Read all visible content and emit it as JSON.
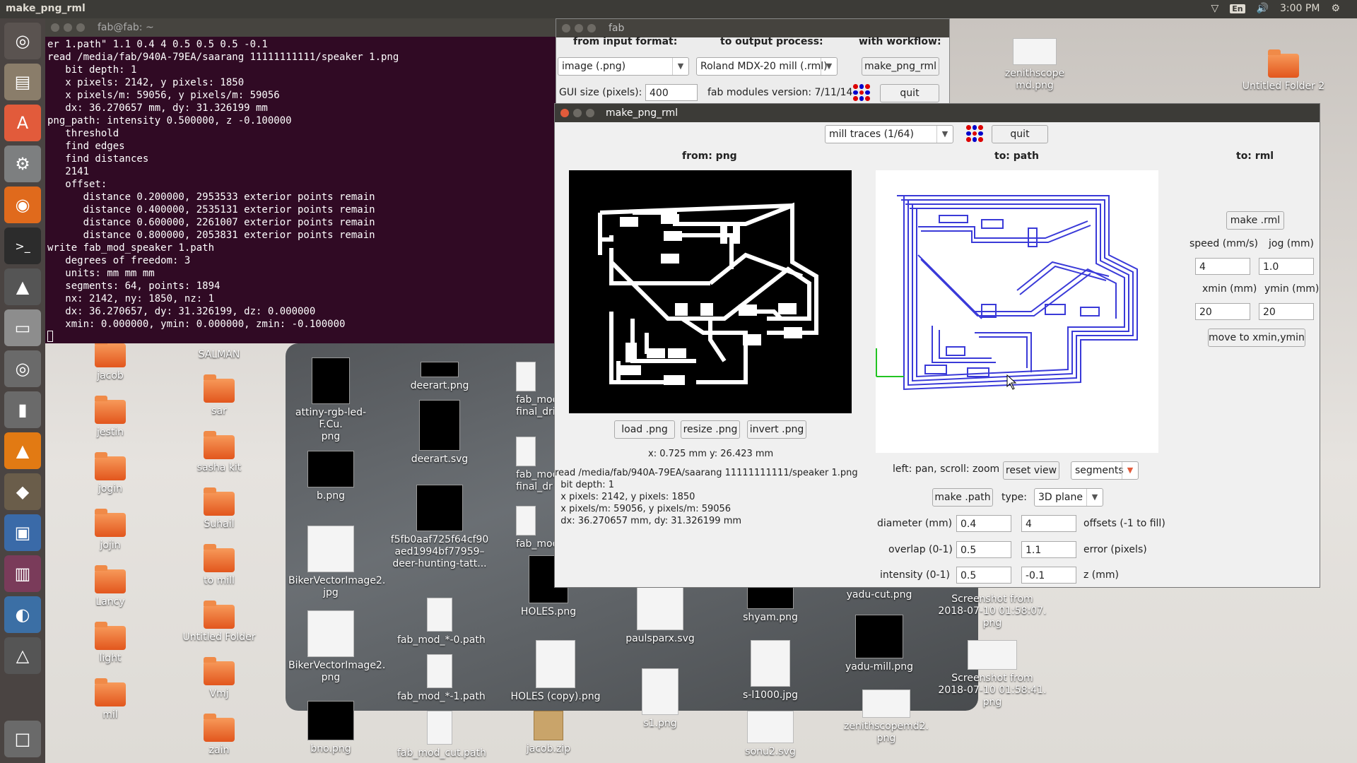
{
  "topbar": {
    "app_title": "make_png_rml",
    "lang": "En",
    "time": "3:00 PM"
  },
  "launcher": {
    "items": [
      "ubuntu-dash-icon",
      "files-icon",
      "software-center-icon",
      "settings-icon",
      "firefox-icon",
      "terminal-icon",
      "inkscape-icon",
      "disk-icon",
      "dvd-icon",
      "usb-icon",
      "vlc-icon",
      "gimp-icon",
      "video-editor-icon",
      "film-icon",
      "python-icon",
      "updater-icon",
      "trash-icon"
    ]
  },
  "terminal": {
    "title": "fab@fab: ~",
    "lines": [
      "er 1.path\" 1.1 0.4 4 0.5 0.5 0.5 -0.1",
      "read /media/fab/940A-79EA/saarang 11111111111/speaker 1.png",
      "   bit depth: 1",
      "   x pixels: 2142, y pixels: 1850",
      "   x pixels/m: 59056, y pixels/m: 59056",
      "   dx: 36.270657 mm, dy: 31.326199 mm",
      "png_path: intensity 0.500000, z -0.100000",
      "   threshold",
      "   find edges",
      "   find distances",
      "   2141",
      "   offset:",
      "      distance 0.200000, 2953533 exterior points remain",
      "      distance 0.400000, 2535131 exterior points remain",
      "      distance 0.600000, 2261007 exterior points remain",
      "      distance 0.800000, 2053831 exterior points remain",
      "write fab_mod_speaker 1.path",
      "   degrees of freedom: 3",
      "   units: mm mm mm",
      "   segments: 64, points: 1894",
      "   nx: 2142, ny: 1850, nz: 1",
      "   dx: 36.270657, dy: 31.326199, dz: 0.000000",
      "   xmin: 0.000000, ymin: 0.000000, zmin: -0.100000"
    ]
  },
  "fab": {
    "title": "fab",
    "from_label": "from input format:",
    "to_label": "to output process:",
    "workflow_label": "with workflow:",
    "input_format": "image (.png)",
    "output_process": "Roland MDX-20 mill (.rml)",
    "workflow": "make_png_rml",
    "gui_size_label": "GUI size (pixels):",
    "gui_size": "400",
    "version": "fab modules version: 7/11/14",
    "quit": "quit"
  },
  "mpr": {
    "title": "make_png_rml",
    "mode": "mill traces (1/64)",
    "quit": "quit",
    "from_png": "from: png",
    "to_path": "to: path",
    "to_rml": "to: rml",
    "load": "load .png",
    "resize": "resize .png",
    "invert": "invert .png",
    "coords": "x: 0.725 mm  y: 26.423 mm",
    "info_lines": [
      "read /media/fab/940A-79EA/saarang 11111111111/speaker 1.png",
      "  bit depth: 1",
      "  x pixels: 2142, y pixels: 1850",
      "  x pixels/m: 59056, y pixels/m: 59056",
      "  dx: 36.270657 mm, dy: 31.326199 mm"
    ],
    "pan_hint": "left: pan, scroll: zoom",
    "reset_view": "reset view",
    "view_mode": "segments",
    "make_path": "make .path",
    "type_label": "type:",
    "type_value": "3D plane",
    "diameter_label": "diameter (mm)",
    "diameter": "0.4",
    "offsets": "4",
    "offsets_label": "offsets (-1 to fill)",
    "overlap_label": "overlap (0-1)",
    "overlap": "0.5",
    "error": "1.1",
    "error_label": "error (pixels)",
    "intensity_label": "intensity (0-1)",
    "intensity": "0.5",
    "z": "-0.1",
    "z_label": "z (mm)",
    "make_rml": "make .rml",
    "speed_label": "speed (mm/s)",
    "jog_label": "jog (mm)",
    "speed": "4",
    "jog": "1.0",
    "xmin_label": "xmin (mm)",
    "ymin_label": "ymin (mm)",
    "xmin": "20",
    "ymin": "20",
    "move": "move to xmin,ymin"
  },
  "desktop": {
    "folders": [
      "jacob",
      "SALMAN",
      "jestin",
      "sar",
      "jogin",
      "sasha kit",
      "jojin",
      "Suhail",
      "Lancy",
      "to mill",
      "light",
      "Untitled Folder",
      "mil",
      "Vmj",
      "zain",
      "Untitled Folder 2"
    ],
    "files": [
      "zenithscope md.png",
      "attiny-rgb-led-F.Cu.\npng",
      "b.png",
      "BikerVectorImage2.\njpg",
      "BikerVectorImage2.\npng",
      "bno.png",
      "deerart.png",
      "deerart.svg",
      "f5fb0aaf725f64cf90\naed1994bf77959–\ndeer-hunting-tatt...",
      "fab_mod_*-0.path",
      "fab_mod_*-1.path",
      "fab_mod_cut.path",
      "fab_mod\nfinal_dri",
      "fab_mod\nfinal_dr",
      "fab_mod_",
      "HOLES.png",
      "HOLES (copy).png",
      "jacob.zip",
      "paulsparx.svg",
      "s1.png",
      "shyam.png",
      "s-l1000.jpg",
      "sonu2.svg",
      "yadu-cut.png",
      "yadu-mill.png",
      "zenithscopemd2.\npng",
      "Screenshot from\n2018-07-10 01:58:07.\npng",
      "Screenshot from\n2018-07-10 01:58:41.\npng"
    ]
  }
}
